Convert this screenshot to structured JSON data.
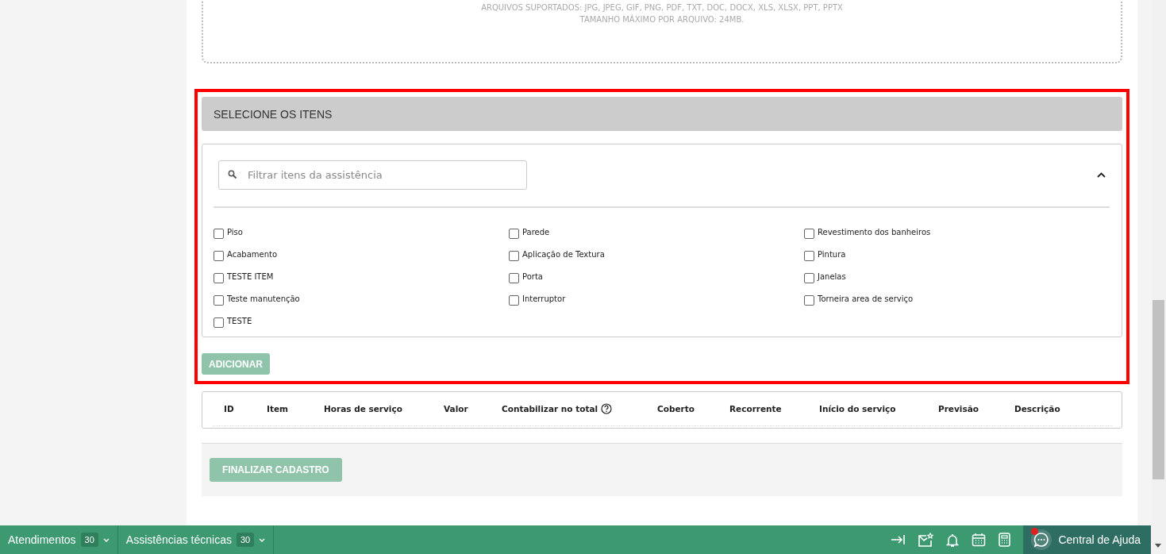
{
  "upload": {
    "lines": [
      "ARQUIVOS SUPORTADOS: JPG, JPEG, GIF, PNG, PDF, TXT, DOC, DOCX, XLS, XLSX, PPT, PPTX",
      "TAMANHO MÁXIMO POR ARQUIVO: 24MB."
    ]
  },
  "items_panel": {
    "title": "SELECIONE OS ITENS",
    "search": {
      "placeholder": "Filtrar itens da assistência"
    },
    "expanded": true,
    "items": [
      {
        "label": "Piso",
        "checked": false
      },
      {
        "label": "Parede",
        "checked": false
      },
      {
        "label": "Revestimento dos banheiros",
        "checked": false
      },
      {
        "label": "Acabamento",
        "checked": false
      },
      {
        "label": "Aplicação de Textura",
        "checked": false
      },
      {
        "label": "Pintura",
        "checked": false
      },
      {
        "label": "TESTE ITEM",
        "checked": false
      },
      {
        "label": "Porta",
        "checked": false
      },
      {
        "label": "Janelas",
        "checked": false
      },
      {
        "label": "Teste manutenção",
        "checked": false
      },
      {
        "label": "Interruptor",
        "checked": false
      },
      {
        "label": "Torneira area de serviço",
        "checked": false
      },
      {
        "label": "TESTE",
        "checked": false
      }
    ],
    "add_button": {
      "label": "ADICIONAR",
      "disabled": true
    }
  },
  "table": {
    "columns": [
      {
        "label": "ID",
        "help": false
      },
      {
        "label": "Item",
        "help": false
      },
      {
        "label": "Horas de serviço",
        "help": false
      },
      {
        "label": "Valor",
        "help": false
      },
      {
        "label": "Contabilizar no total",
        "help": true
      },
      {
        "label": "Coberto",
        "help": false
      },
      {
        "label": "Recorrente",
        "help": false
      },
      {
        "label": "Início do serviço",
        "help": false
      },
      {
        "label": "Previsão",
        "help": false
      },
      {
        "label": "Descrição",
        "help": false
      }
    ]
  },
  "finish_button": {
    "label": "FINALIZAR CADASTRO",
    "disabled": true
  },
  "bottom_bar": {
    "tabs": [
      {
        "label": "Atendimentos",
        "count": "30"
      },
      {
        "label": "Assistências técnicas",
        "count": "30"
      }
    ],
    "help": {
      "label": "Central de Ajuda",
      "notification": true
    }
  }
}
